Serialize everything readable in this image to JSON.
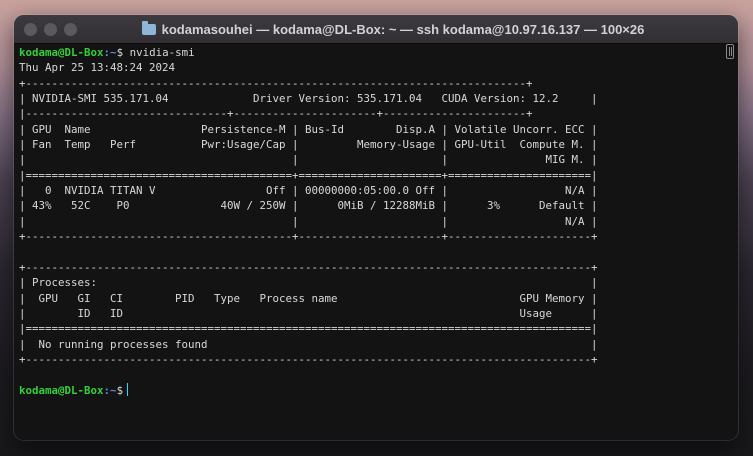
{
  "window": {
    "title": "kodamasouhei — kodama@DL-Box: ~ — ssh kodama@10.97.16.137 — 100×26",
    "folder_icon": "folder-icon"
  },
  "prompt": {
    "user": "kodama",
    "at": "@",
    "host": "DL-Box",
    "path": ":~",
    "symbol": "$"
  },
  "command": " nvidia-smi",
  "terminal_output": [
    "Thu Apr 25 13:48:24 2024",
    "+-----------------------------------------------------------------------------+",
    "| NVIDIA-SMI 535.171.04             Driver Version: 535.171.04   CUDA Version: 12.2     |",
    "|-------------------------------+----------------------+----------------------+",
    "| GPU  Name                 Persistence-M | Bus-Id        Disp.A | Volatile Uncorr. ECC |",
    "| Fan  Temp   Perf          Pwr:Usage/Cap |         Memory-Usage | GPU-Util  Compute M. |",
    "|                                         |                      |               MIG M. |",
    "|=========================================+======================+======================|",
    "|   0  NVIDIA TITAN V                 Off | 00000000:05:00.0 Off |                  N/A |",
    "| 43%   52C    P0              40W / 250W |      0MiB / 12288MiB |      3%      Default |",
    "|                                         |                      |                  N/A |",
    "+-----------------------------------------+----------------------+----------------------+",
    "",
    "+---------------------------------------------------------------------------------------+",
    "| Processes:                                                                            |",
    "|  GPU   GI   CI        PID   Type   Process name                            GPU Memory |",
    "|        ID   ID                                                             Usage      |",
    "|=======================================================================================|",
    "|  No running processes found                                                           |",
    "+---------------------------------------------------------------------------------------+"
  ],
  "colors": {
    "prompt_user_host": "#35d03a",
    "prompt_path": "#5b8be0",
    "terminal_bg": "#131313",
    "terminal_text": "#d8d8d8",
    "cursor": "#32d2ff"
  }
}
